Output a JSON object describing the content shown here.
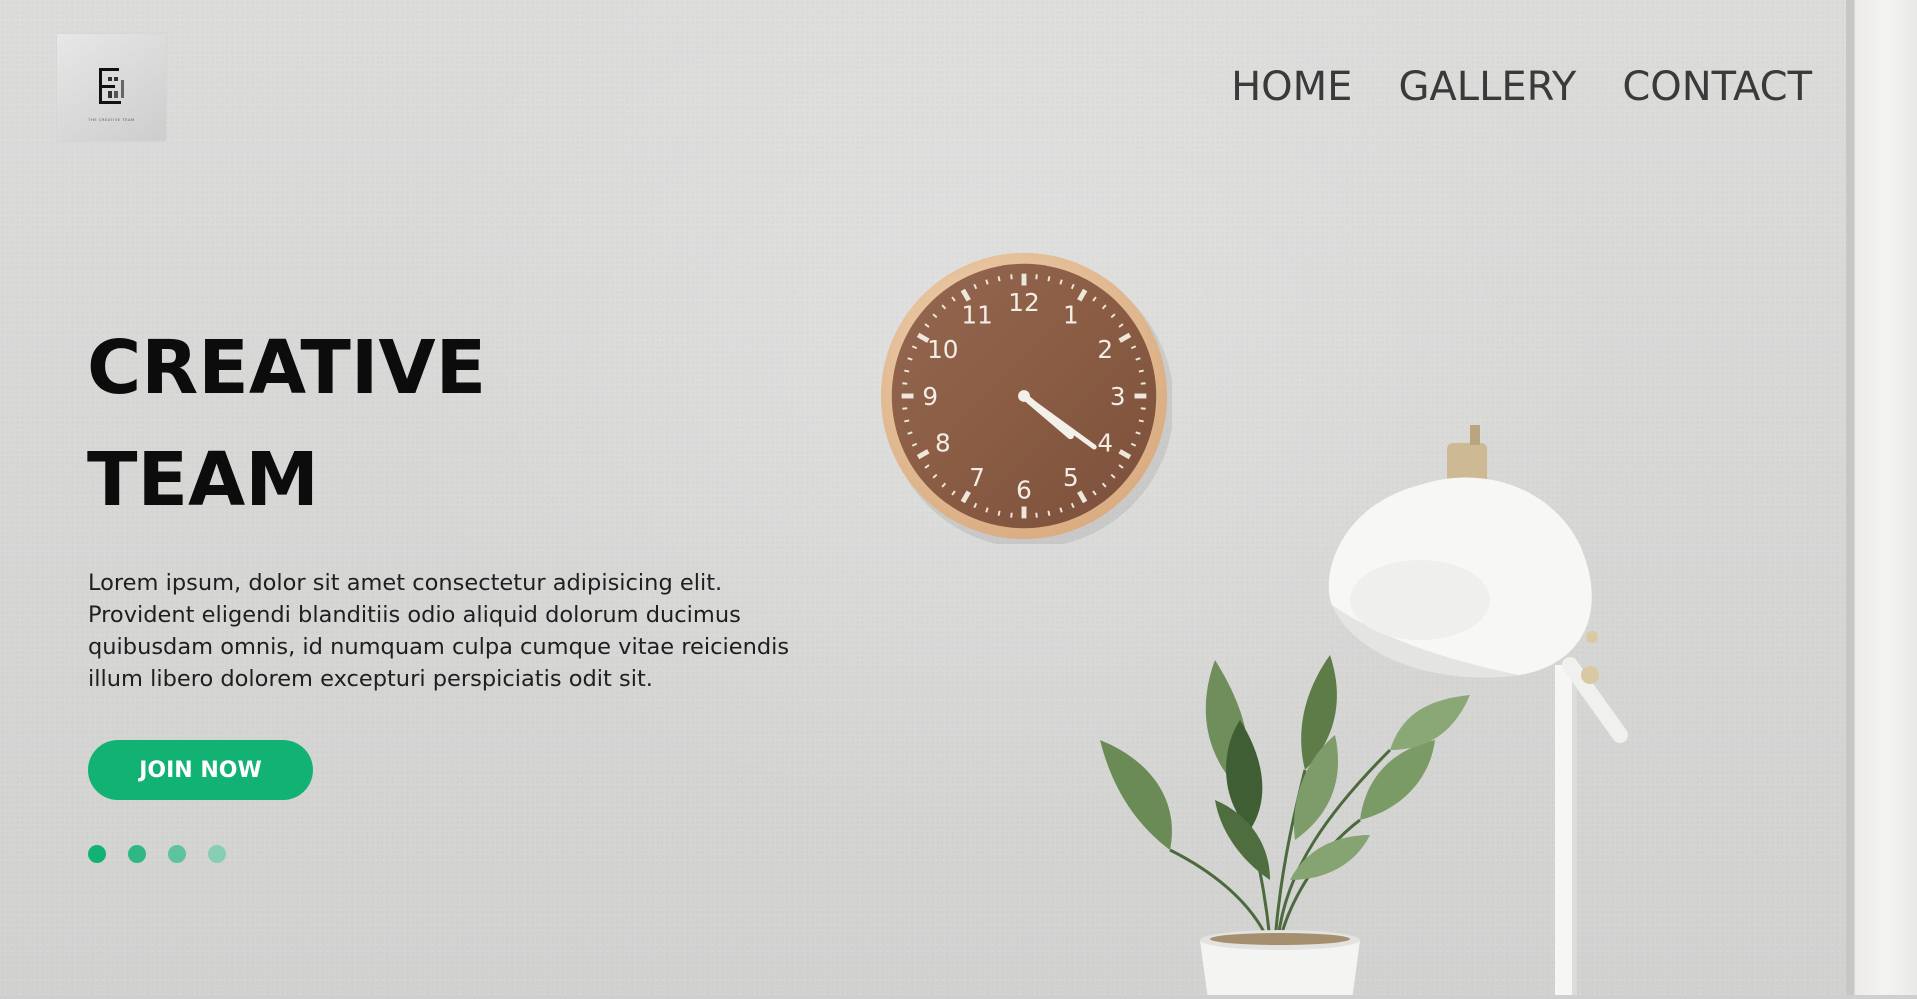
{
  "header": {
    "logo_caption": "THE CREATIVE TEAM",
    "nav": [
      "HOME",
      "GALLERY",
      "CONTACT"
    ]
  },
  "hero": {
    "title_line1": "CREATIVE",
    "title_line2": "TEAM",
    "description": "Lorem ipsum, dolor sit amet consectetur adipisicing elit. Provident eligendi blanditiis odio aliquid dolorum ducimus quibusdam omnis, id numquam culpa cumque vitae reiciendis illum libero dolorem excepturi perspiciatis odit sit.",
    "cta_label": "JOIN NOW",
    "slide_dots": [
      {
        "color": "#12b274",
        "active": true
      },
      {
        "color": "#2fb884",
        "active": false
      },
      {
        "color": "#5cc39c",
        "active": false
      },
      {
        "color": "#86cfb2",
        "active": false
      }
    ]
  },
  "clock": {
    "numerals": [
      "12",
      "1",
      "2",
      "3",
      "4",
      "5",
      "6",
      "7",
      "8",
      "9",
      "10",
      "11"
    ],
    "hour": 4,
    "minute": 21
  },
  "colors": {
    "accent": "#12b274",
    "heading": "#0c0c0c",
    "nav_text": "#3a3a3a",
    "background": "#d8d8d7"
  }
}
